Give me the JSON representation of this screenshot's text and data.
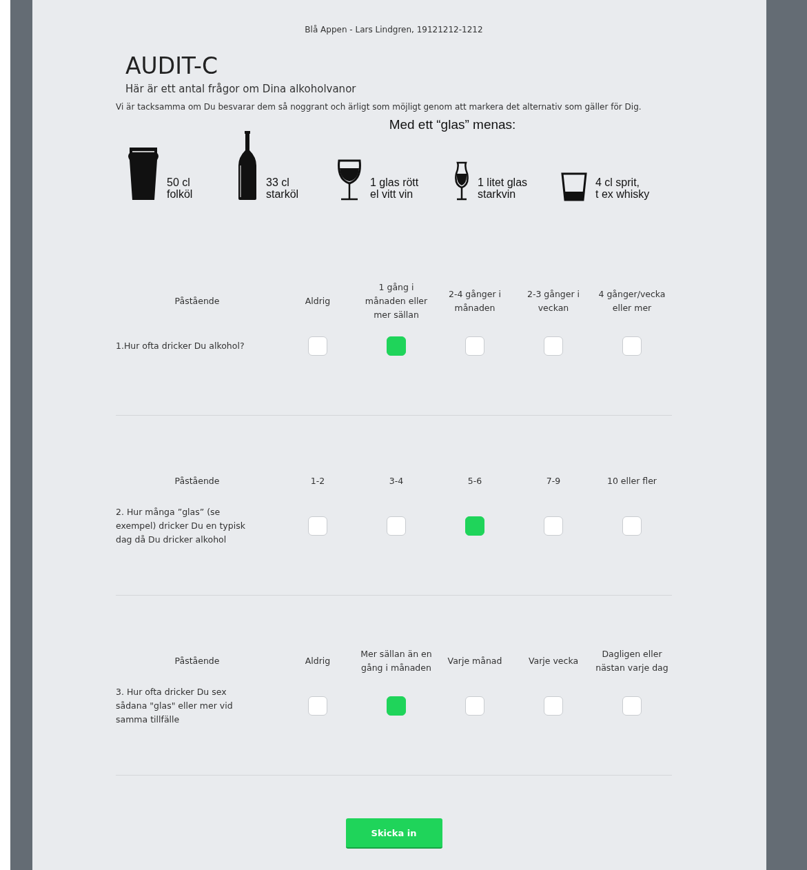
{
  "header": {
    "text": "Blå Appen - Lars Lindgren, 19121212-1212"
  },
  "title": "AUDIT-C",
  "subtitle": "Här är ett antal frågor om Dina alkoholvanor",
  "intro": "Vi är tacksamma om Du besvarar dem så noggrant och ärligt som möjligt genom att markera det alternativ som gäller för Dig.",
  "legend": {
    "title": "Med ett “glas” menas:",
    "items": [
      {
        "kind": "pint",
        "lines": [
          "50 cl",
          "folköl"
        ]
      },
      {
        "kind": "bottle",
        "lines": [
          "33 cl",
          "starköl"
        ]
      },
      {
        "kind": "wine",
        "lines": [
          "1 glas rött",
          "el vitt vin"
        ]
      },
      {
        "kind": "tulip",
        "lines": [
          "1 litet glas",
          "starkvin"
        ]
      },
      {
        "kind": "tumbler",
        "lines": [
          "4 cl sprit,",
          "t ex whisky"
        ]
      }
    ]
  },
  "questions": [
    {
      "header": "Påstående",
      "text": "1.Hur ofta dricker Du alkohol?",
      "options": [
        {
          "label": "Aldrig",
          "selected": false
        },
        {
          "label": "1 gång i månaden eller mer sällan",
          "selected": true
        },
        {
          "label": "2-4 gånger i månaden",
          "selected": false
        },
        {
          "label": "2-3 gånger i veckan",
          "selected": false
        },
        {
          "label": "4 gånger/vecka eller mer",
          "selected": false
        }
      ]
    },
    {
      "header": "Påstående",
      "text": "2. Hur många ”glas” (se exempel) dricker Du en typisk dag då Du dricker alkohol",
      "options": [
        {
          "label": "1-2",
          "selected": false
        },
        {
          "label": "3-4",
          "selected": false
        },
        {
          "label": "5-6",
          "selected": true
        },
        {
          "label": "7-9",
          "selected": false
        },
        {
          "label": "10 eller fler",
          "selected": false
        }
      ]
    },
    {
      "header": "Påstående",
      "text": "3. Hur ofta dricker Du sex sådana \"glas\" eller mer vid samma tillfälle",
      "options": [
        {
          "label": "Aldrig",
          "selected": false
        },
        {
          "label": "Mer sällan än en gång i månaden",
          "selected": true
        },
        {
          "label": "Varje månad",
          "selected": false
        },
        {
          "label": "Varje vecka",
          "selected": false
        },
        {
          "label": "Dagligen eller nästan varje dag",
          "selected": false
        }
      ]
    }
  ],
  "submit": "Skicka in"
}
